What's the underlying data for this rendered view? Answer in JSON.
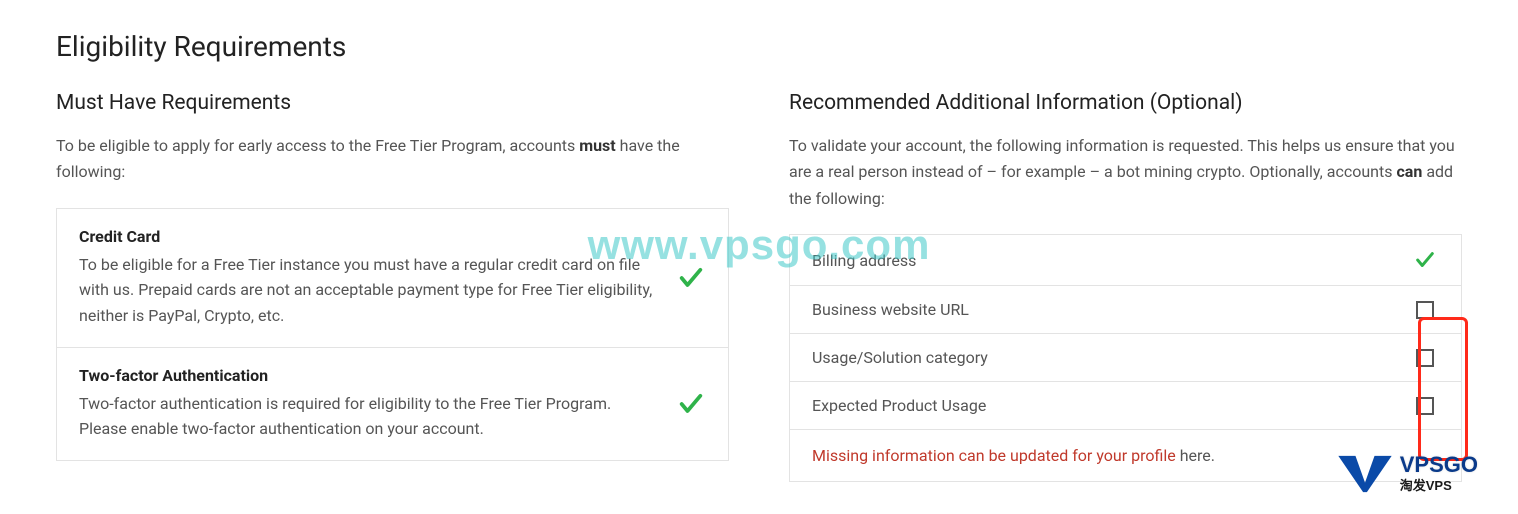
{
  "page_title": "Eligibility Requirements",
  "left": {
    "section_title": "Must Have Requirements",
    "intro_pre": "To be eligible to apply for early access to the Free Tier Program, accounts ",
    "intro_bold": "must",
    "intro_post": " have the following:",
    "cards": [
      {
        "title": "Credit Card",
        "desc": "To be eligible for a Free Tier instance you must have a regular credit card on file with us. Prepaid cards are not an acceptable payment type for Free Tier eligibility, neither is PayPal, Crypto, etc.",
        "status": "ok"
      },
      {
        "title": "Two-factor Authentication",
        "desc": "Two-factor authentication is required for eligibility to the Free Tier Program. Please enable two-factor authentication on your account.",
        "status": "ok"
      }
    ]
  },
  "right": {
    "section_title": "Recommended Additional Information (Optional)",
    "intro_pre": "To validate your account, the following information is requested. This helps us ensure that you are a real person instead of – for example – a bot mining crypto. Optionally, accounts ",
    "intro_bold": "can",
    "intro_post": " add the following:",
    "rows": [
      {
        "label": "Billing address",
        "status": "ok"
      },
      {
        "label": "Business website URL",
        "status": "missing"
      },
      {
        "label": "Usage/Solution category",
        "status": "missing"
      },
      {
        "label": "Expected Product Usage",
        "status": "missing"
      }
    ],
    "missing_link_text": "Missing information can be updated for your profile",
    "missing_tail": " here."
  },
  "watermark_center": "www.vpsgo.com",
  "watermark_corner_main": "VPSGO",
  "watermark_corner_sub": "淘发VPS"
}
